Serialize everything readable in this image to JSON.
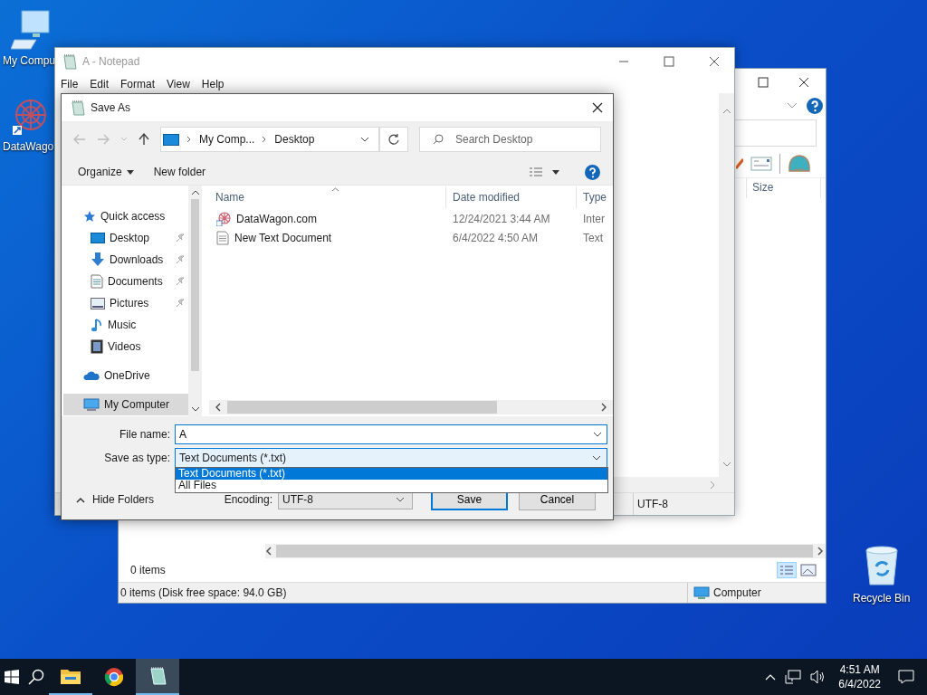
{
  "desktop_icons": [
    {
      "label": "My Compu",
      "kind": "computer"
    },
    {
      "label": "DataWago",
      "kind": "shortcut"
    },
    {
      "label": "Recycle Bin",
      "kind": "recycle"
    }
  ],
  "background_window": {
    "column": "Size",
    "item_count": "0 items",
    "status_bar": "0 items (Disk free space: 94.0 GB)",
    "location": "Computer"
  },
  "notepad": {
    "title": "A - Notepad",
    "menu": [
      "File",
      "Edit",
      "Format",
      "View",
      "Help"
    ],
    "encoding": "UTF-8"
  },
  "save_dialog": {
    "title": "Save As",
    "breadcrumb": [
      "My Comp...",
      "Desktop"
    ],
    "search": {
      "placeholder": "Search Desktop"
    },
    "toolbar": [
      "Organize",
      "New folder"
    ],
    "nav": [
      {
        "label": "Quick access",
        "kind": "quick",
        "selected": false,
        "children": [
          {
            "label": "Desktop",
            "kind": "desktop",
            "pinned": true,
            "selected": false
          },
          {
            "label": "Downloads",
            "kind": "downloads",
            "pinned": true,
            "selected": false
          },
          {
            "label": "Documents",
            "kind": "documents",
            "pinned": true,
            "selected": false
          },
          {
            "label": "Pictures",
            "kind": "pictures",
            "pinned": true,
            "selected": false
          },
          {
            "label": "Music",
            "kind": "music",
            "pinned": false,
            "selected": false
          },
          {
            "label": "Videos",
            "kind": "videos",
            "pinned": false,
            "selected": false
          }
        ]
      },
      {
        "label": "OneDrive",
        "kind": "cloud",
        "selected": false
      },
      {
        "label": "My Computer",
        "kind": "computer",
        "selected": true
      }
    ],
    "columns": [
      "Name",
      "Date modified",
      "Type"
    ],
    "files": [
      {
        "name": "DataWagon.com",
        "kind": "shortcut",
        "date": "12/24/2021 3:44 AM",
        "type": "Inter"
      },
      {
        "name": "New Text Document",
        "kind": "text",
        "date": "6/4/2022 4:50 AM",
        "type": "Text"
      }
    ],
    "file_name": {
      "label": "File name:",
      "value": "A"
    },
    "save_type": {
      "label": "Save as type:",
      "value": "Text Documents (*.txt)",
      "expanded": true,
      "options": [
        {
          "label": "Text Documents (*.txt)",
          "selected": true
        },
        {
          "label": "All Files",
          "selected": false
        }
      ]
    },
    "hide_folders": "Hide Folders",
    "encoding": {
      "label": "Encoding:",
      "value": "UTF-8"
    },
    "buttons": [
      "Save",
      "Cancel"
    ]
  },
  "taskbar": {
    "apps": [
      {
        "kind": "explorer",
        "running": true,
        "selected": false
      },
      {
        "kind": "chrome",
        "running": false,
        "selected": false
      },
      {
        "kind": "notepad",
        "running": true,
        "selected": true
      }
    ],
    "time": "4:51 AM",
    "date": "6/4/2022"
  }
}
